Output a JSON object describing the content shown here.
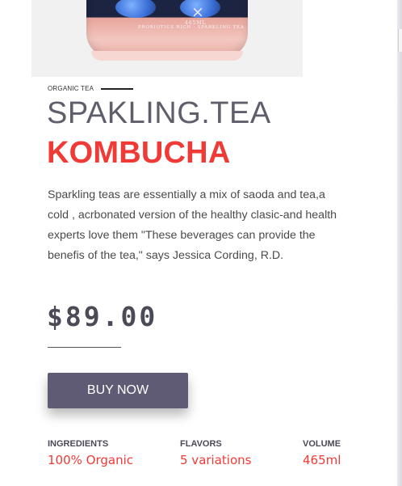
{
  "photo": {
    "bottle_volume_text": "465ML",
    "bottle_tagline": "PROBIOTICS RICH · SPARKLING TEA",
    "bottle_mark": "×"
  },
  "category": {
    "label": "ORGANIC TEA"
  },
  "title": {
    "line1": "SPAKLING.TEA",
    "line2": "KOMBUCHA"
  },
  "description": "Sparkling teas are essentially a mix of saoda and tea,a cold , acrbonated version of the healthy clasic-and health experts love them \"These beverages can provide the benefis of the tea,\" says Jessica Cording, R.D.",
  "price": "$89.00",
  "cta": {
    "label": "BUY NOW"
  },
  "specs": [
    {
      "label": "INGREDIENTS",
      "value": "100% Organic"
    },
    {
      "label": "FLAVORS",
      "value": "5 variations"
    },
    {
      "label": "VOLUME",
      "value": "465ml"
    }
  ],
  "colors": {
    "accent": "#f03a35",
    "title_gray": "#5f5f6c",
    "button": "#5f5b75"
  }
}
